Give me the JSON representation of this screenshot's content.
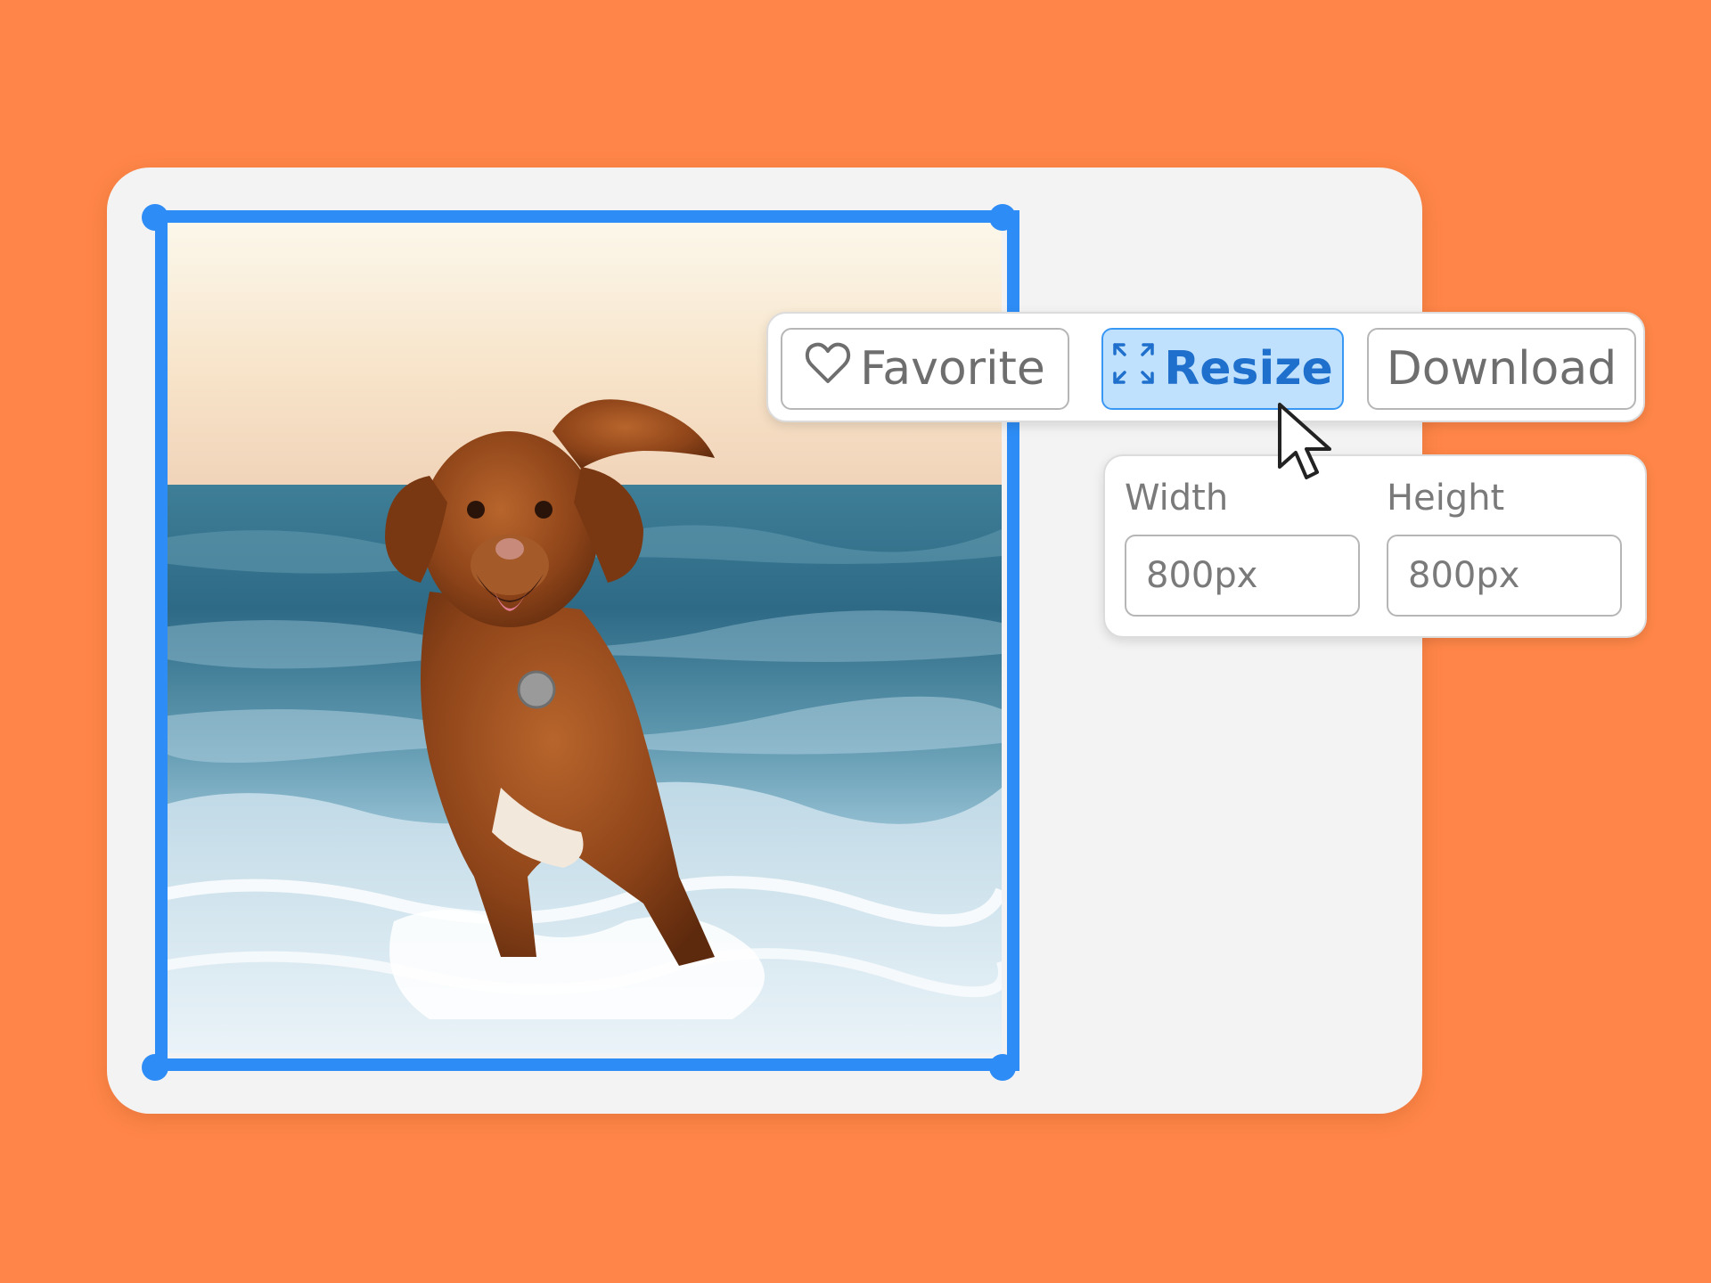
{
  "toolbar": {
    "favorite": {
      "label": "Favorite",
      "icon": "heart-icon"
    },
    "resize": {
      "label": "Resize",
      "icon": "expand-arrows-icon",
      "state": "hover"
    },
    "download": {
      "label": "Download"
    }
  },
  "resize_panel": {
    "width": {
      "label": "Width",
      "value": "800px"
    },
    "height": {
      "label": "Height",
      "value": "800px"
    }
  },
  "image": {
    "subject": "dog running in ocean surf",
    "selected": true
  },
  "colors": {
    "background": "#FF8648",
    "card": "#F3F3F3",
    "selection": "#2D8CF5",
    "resize_button_fill": "#BFE1FD",
    "resize_button_text": "#1F6FCC",
    "button_text": "#6E6E6E"
  }
}
